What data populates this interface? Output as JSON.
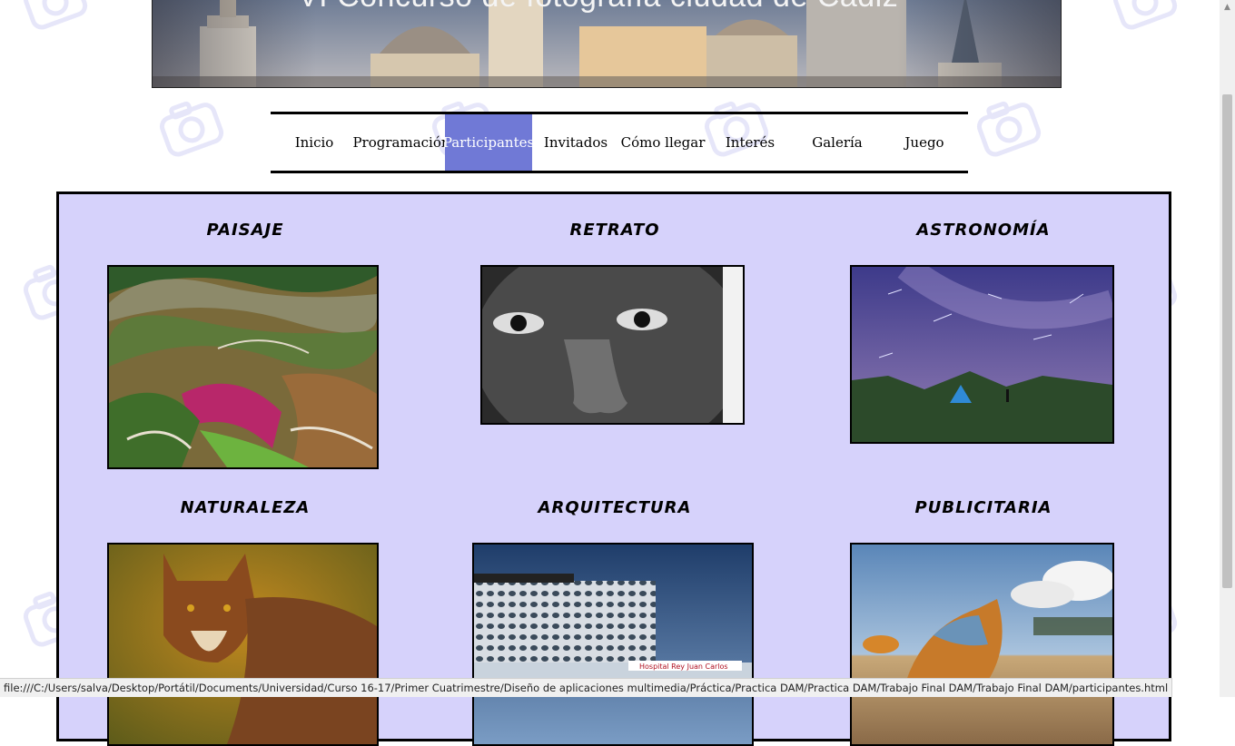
{
  "banner": {
    "title": "VI Concurso de fotografía ciudad de Cádiz"
  },
  "nav": {
    "items": [
      "Inicio",
      "Programación",
      "Participantes",
      "Invitados",
      "Cómo llegar",
      "Interés",
      "Galería",
      "Juego"
    ],
    "active": "Participantes"
  },
  "categories": {
    "c1": "PAISAJE",
    "c2": "RETRATO",
    "c3": "ASTRONOMÍA",
    "c4": "NATURALEZA",
    "c5": "ARQUITECTURA",
    "c6": "PUBLICITARIA"
  },
  "photos": {
    "arquitectura_sign": "Hospital Rey Juan Carlos"
  },
  "colors": {
    "panel_bg": "#d6d2fb",
    "nav_active": "#7079d6"
  },
  "statusbar": {
    "url": "file:///C:/Users/salva/Desktop/Portátil/Documents/Universidad/Curso 16-17/Primer Cuatrimestre/Diseño de aplicaciones multimedia/Práctica/Practica DAM/Practica DAM/Trabajo Final DAM/Trabajo Final DAM/participantes.html"
  }
}
